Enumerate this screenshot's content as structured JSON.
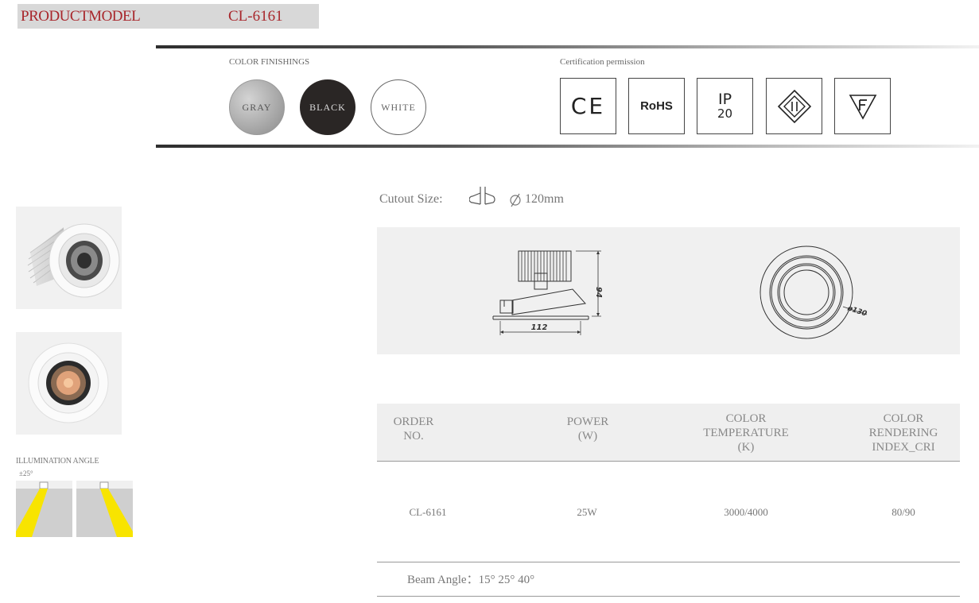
{
  "header": {
    "label": "PRODUCTMODEL",
    "model": "CL-6161"
  },
  "finishes": {
    "title": "COLOR FINISHINGS",
    "items": [
      "GRAY",
      "BLACK",
      "WHITE"
    ]
  },
  "certifications": {
    "title": "Certification permission",
    "ce": "CE",
    "rohs": "RoHS",
    "ip_top": "IP",
    "ip_bottom": "20"
  },
  "illumination": {
    "title": "ILLUMINATION ANGLE",
    "angle": "±25°"
  },
  "cutout": {
    "label": "Cutout Size:",
    "size": "120mm"
  },
  "drawing": {
    "height": "94",
    "width": "112",
    "diameter": "ø130"
  },
  "spec_table": {
    "headers": [
      [
        "ORDER",
        "NO."
      ],
      [
        "POWER",
        "(W)"
      ],
      [
        "COLOR",
        "TEMPERATURE",
        "(K)"
      ],
      [
        "COLOR",
        "RENDERING",
        "INDEX_CRI"
      ]
    ],
    "row": [
      "CL-6161",
      "25W",
      "3000/4000",
      "80/90"
    ],
    "beam_angle": "Beam Angle：15°  25°  40°"
  }
}
